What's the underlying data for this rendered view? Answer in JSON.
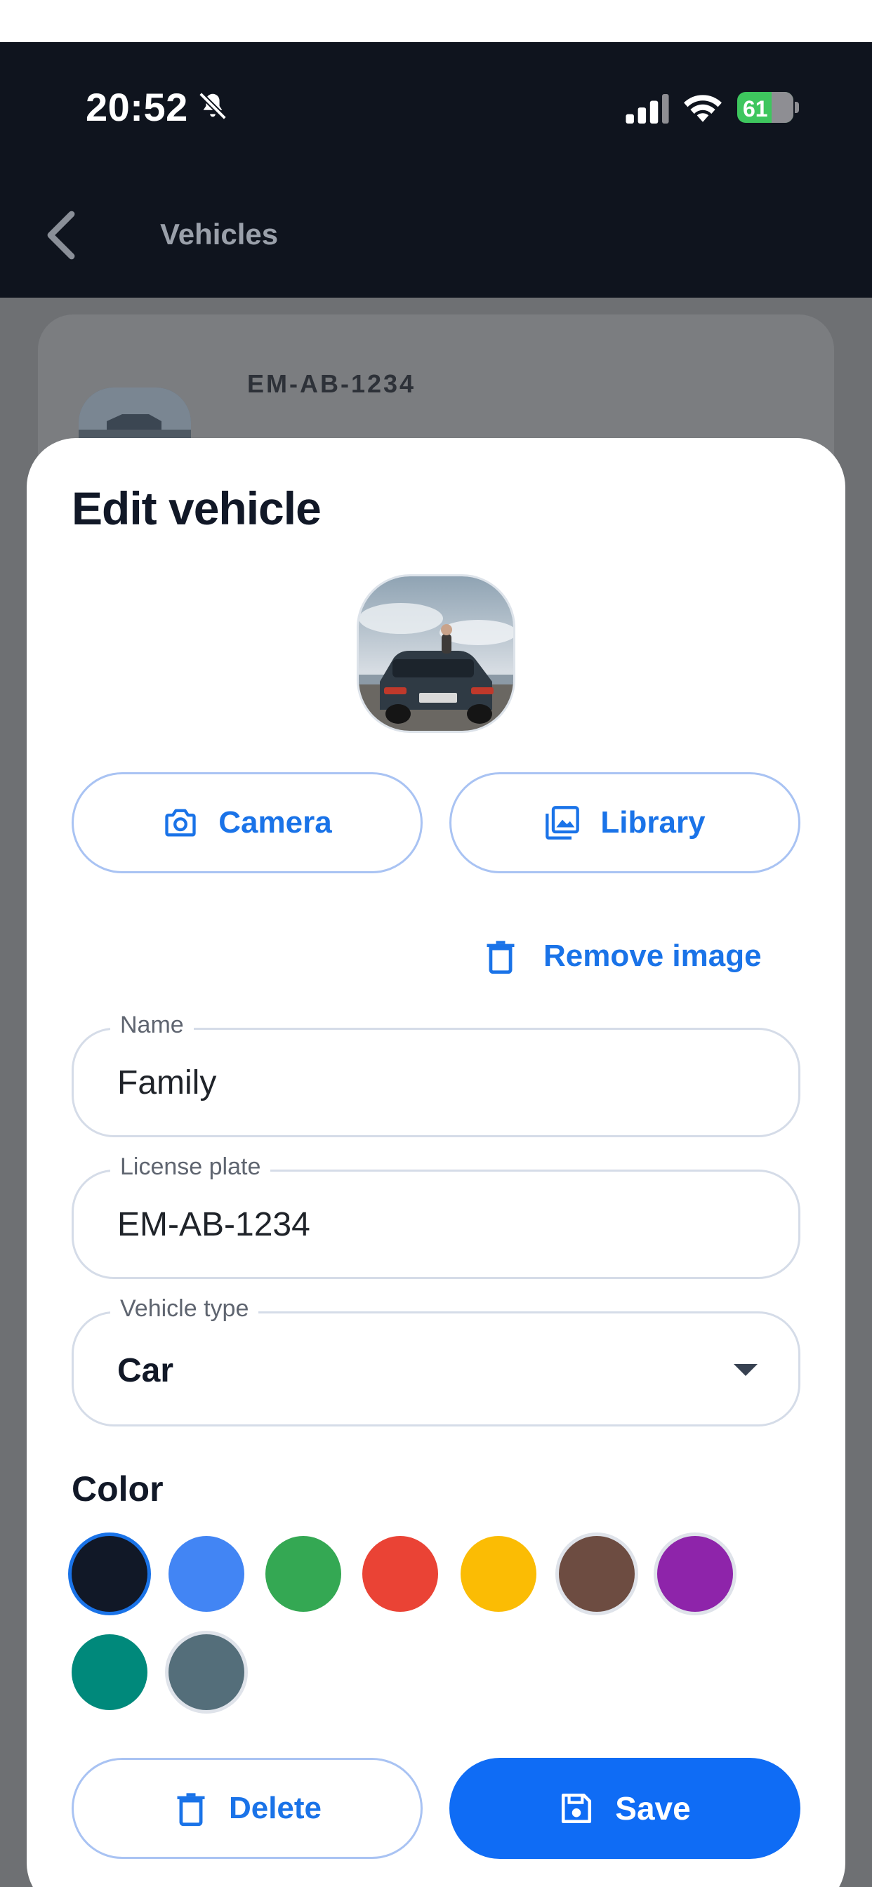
{
  "status_bar": {
    "time": "20:52",
    "battery": "61",
    "battery_level": 0.61,
    "icons": [
      "bell-muted-icon",
      "cellular-signal-icon",
      "wifi-icon",
      "battery-charging-icon"
    ]
  },
  "nav": {
    "title": "Vehicles",
    "back_icon": "chevron-left-icon"
  },
  "background_list": {
    "plate": "EM-AB-1234"
  },
  "sheet": {
    "title": "Edit vehicle",
    "camera_label": "Camera",
    "library_label": "Library",
    "remove_image_label": "Remove image",
    "name": {
      "label": "Name",
      "value": "Family"
    },
    "license_plate": {
      "label": "License plate",
      "value": "EM-AB-1234"
    },
    "vehicle_type": {
      "label": "Vehicle type",
      "value": "Car"
    },
    "color_heading": "Color",
    "colors": [
      {
        "hex": "#111827",
        "selected": true
      },
      {
        "hex": "#4285f4",
        "selected": false
      },
      {
        "hex": "#34a853",
        "selected": false
      },
      {
        "hex": "#ea4335",
        "selected": false
      },
      {
        "hex": "#fbbc04",
        "selected": false
      },
      {
        "hex": "#6d4c41",
        "selected": false
      },
      {
        "hex": "#8e24aa",
        "selected": false
      },
      {
        "hex": "#00897b",
        "selected": false
      },
      {
        "hex": "#546e7a",
        "selected": false
      }
    ],
    "delete_label": "Delete",
    "save_label": "Save"
  },
  "theme": {
    "accent": "#1a73e8",
    "primary_button": "#0f6cf5",
    "header_bg": "#0f141e"
  }
}
